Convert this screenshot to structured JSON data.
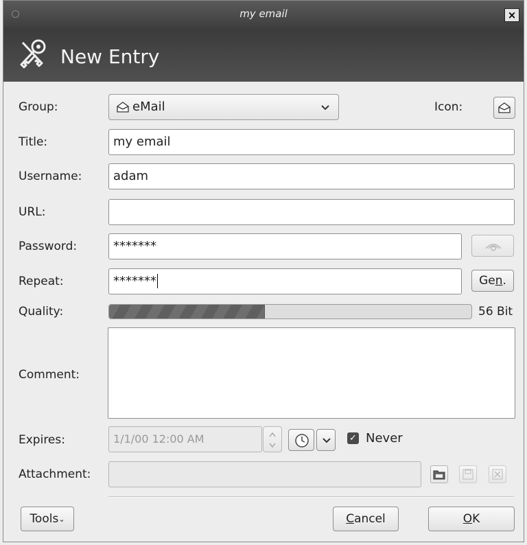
{
  "window": {
    "title": "my email"
  },
  "banner": {
    "title": "New Entry"
  },
  "labels": {
    "group": "Group:",
    "icon": "Icon:",
    "title": "Title:",
    "username": "Username:",
    "url": "URL:",
    "password": "Password:",
    "repeat": "Repeat:",
    "quality": "Quality:",
    "comment": "Comment:",
    "expires": "Expires:",
    "attachment": "Attachment:"
  },
  "fields": {
    "group": "eMail",
    "title": "my email",
    "username": "adam",
    "url": "",
    "password": "*******",
    "repeat": "*******",
    "quality_value": 0.43,
    "quality_text": "56 Bit",
    "comment": "",
    "expires": "1/1/00 12:00 AM",
    "never_label": "Never",
    "never_checked": true,
    "attachment": ""
  },
  "buttons": {
    "gen_pre": "Ge",
    "gen_u": "n",
    "gen_post": ".",
    "tools": "Tools",
    "cancel_u": "C",
    "cancel_rest": "ancel",
    "ok_u": "O",
    "ok_rest": "K"
  },
  "icons": {
    "header": "keys-icon",
    "group": "envelope-icon",
    "eye": "eye-icon",
    "clock": "clock-icon",
    "open": "folder-open-icon",
    "save": "save-icon",
    "delete": "delete-icon"
  }
}
